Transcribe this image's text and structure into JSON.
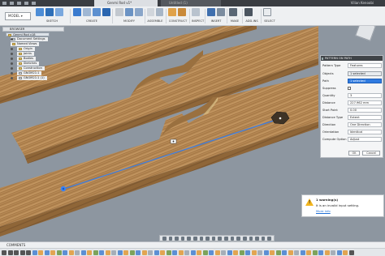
{
  "titlebar": {
    "active_tab": "Genmi Rod v1*",
    "second_tab": "Untitled (1)",
    "user": "Vilian Kenoobi"
  },
  "toolbar": {
    "workspace": "MODEL",
    "groups": [
      "SKETCH",
      "CREATE",
      "MODIFY",
      "ASSEMBLE",
      "CONSTRUCT",
      "INSPECT",
      "INSERT",
      "MAKE",
      "ADD-INS",
      "SELECT"
    ]
  },
  "browser": {
    "title": "BROWSER",
    "items": [
      {
        "label": "Genmi Rod v18",
        "selected": true
      },
      {
        "label": "Document Settings"
      },
      {
        "label": "Named Views"
      },
      {
        "label": "Origin"
      },
      {
        "label": "Joints"
      },
      {
        "label": "Bodies"
      },
      {
        "label": "Sketches"
      },
      {
        "label": "Construction"
      },
      {
        "label": "GNOM21:1"
      },
      {
        "label": "GNOM21:1 (1)"
      }
    ]
  },
  "pattern_panel": {
    "title": "PATTERN ON PATH",
    "rows": [
      {
        "label": "Pattern Type",
        "value": "Features"
      },
      {
        "label": "Objects",
        "value": "1 selected"
      },
      {
        "label": "Path",
        "value": "1 selected"
      },
      {
        "label": "Suppress",
        "value": ""
      },
      {
        "label": "Quantity",
        "value": "3"
      },
      {
        "label": "Distance",
        "value": "227.962 mm"
      },
      {
        "label": "Start Point",
        "value": "0.00"
      },
      {
        "label": "Distance Type",
        "value": "Extent"
      },
      {
        "label": "Direction",
        "value": "One Direction"
      },
      {
        "label": "Orientation",
        "value": "Identical"
      },
      {
        "label": "Compute Option",
        "value": "Adjust"
      }
    ],
    "ok_label": "OK",
    "cancel_label": "Cancel"
  },
  "warning": {
    "title": "1 warning(s)",
    "message": "It is an invalid input setting.",
    "link": "More info"
  },
  "bottom": {
    "comments_label": "COMMENTS"
  },
  "colors": {
    "wood": "#b98c57",
    "path_line": "#3d7de0",
    "panel_header": "#3f4347",
    "warning": "#f2b51e"
  }
}
